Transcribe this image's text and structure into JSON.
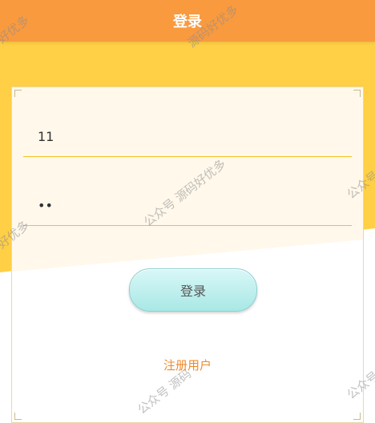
{
  "header": {
    "title": "登录"
  },
  "form": {
    "username_value": "11",
    "password_value": "12",
    "login_label": "登录",
    "register_label": "注册用户"
  },
  "watermark": {
    "text_full": "公众号 源码好优多",
    "text_partial_1": "公众号 源码",
    "text_partial_2": "源码好优多",
    "text_partial_3": "好优多",
    "text_partial_4": "公众号"
  },
  "colors": {
    "header": "#f99a3f",
    "background": "#ffcf45",
    "card": "#fff8eb",
    "field_underline": "#f3c21f",
    "button": "#a8e8e6",
    "link": "#f08a2a"
  }
}
